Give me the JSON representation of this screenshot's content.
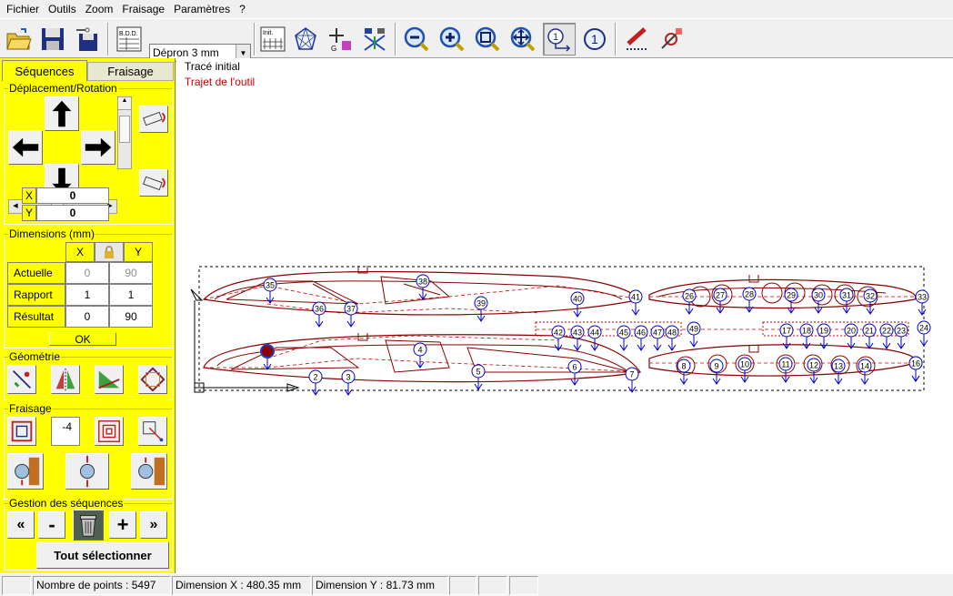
{
  "menu": [
    "Fichier",
    "Outils",
    "Zoom",
    "Fraisage",
    "Paramètres",
    "?"
  ],
  "toolbar": {
    "material_value": "Dépron 3 mm",
    "bdd_label": "B.D.D.",
    "init_label": "Init."
  },
  "tabs": {
    "sequences": "Séquences",
    "fraisage": "Fraisage"
  },
  "deplacement": {
    "title": "Déplacement/Rotation",
    "x_label": "X",
    "y_label": "Y",
    "x_value": "0",
    "y_value": "0"
  },
  "dimensions": {
    "title": "Dimensions (mm)",
    "col_x": "X",
    "col_y": "Y",
    "rows": [
      {
        "label": "Actuelle",
        "x": "0",
        "y": "90"
      },
      {
        "label": "Rapport",
        "x": "1",
        "y": "1"
      },
      {
        "label": "Résultat",
        "x": "0",
        "y": "90"
      }
    ],
    "ok_label": "OK"
  },
  "geometrie": {
    "title": "Géométrie"
  },
  "fraisage": {
    "title": "Fraisage",
    "offset_value": "-4"
  },
  "gestion": {
    "title": "Gestion des séquences",
    "first": "«",
    "minus": "-",
    "plus": "+",
    "last": "»",
    "select_all": "Tout sélectionner"
  },
  "legend": {
    "initial": "Tracé initial",
    "toolpath": "Trajet de l'outil",
    "initial_color": "#000000",
    "toolpath_color": "#cc0000"
  },
  "canvas": {
    "outline_color": "#8b0000",
    "marker_color": "#0000cc",
    "markers_top": [
      "35",
      "36",
      "37",
      "38",
      "39",
      "40",
      "41",
      "26",
      "27",
      "28",
      "29",
      "30",
      "31",
      "32",
      "33"
    ],
    "markers_mid": [
      "42",
      "43",
      "44",
      "45",
      "46",
      "47",
      "48",
      "49",
      "17",
      "18",
      "19",
      "20",
      "21",
      "22",
      "23",
      "24"
    ],
    "markers_bottom": [
      "1",
      "2",
      "3",
      "4",
      "5",
      "6",
      "7",
      "8",
      "9",
      "10",
      "11",
      "12",
      "13",
      "14",
      "15",
      "16"
    ]
  },
  "status": {
    "points": "Nombre de points : 5497",
    "dim_x": "Dimension X : 480.35 mm",
    "dim_y": "Dimension Y : 81.73 mm"
  }
}
